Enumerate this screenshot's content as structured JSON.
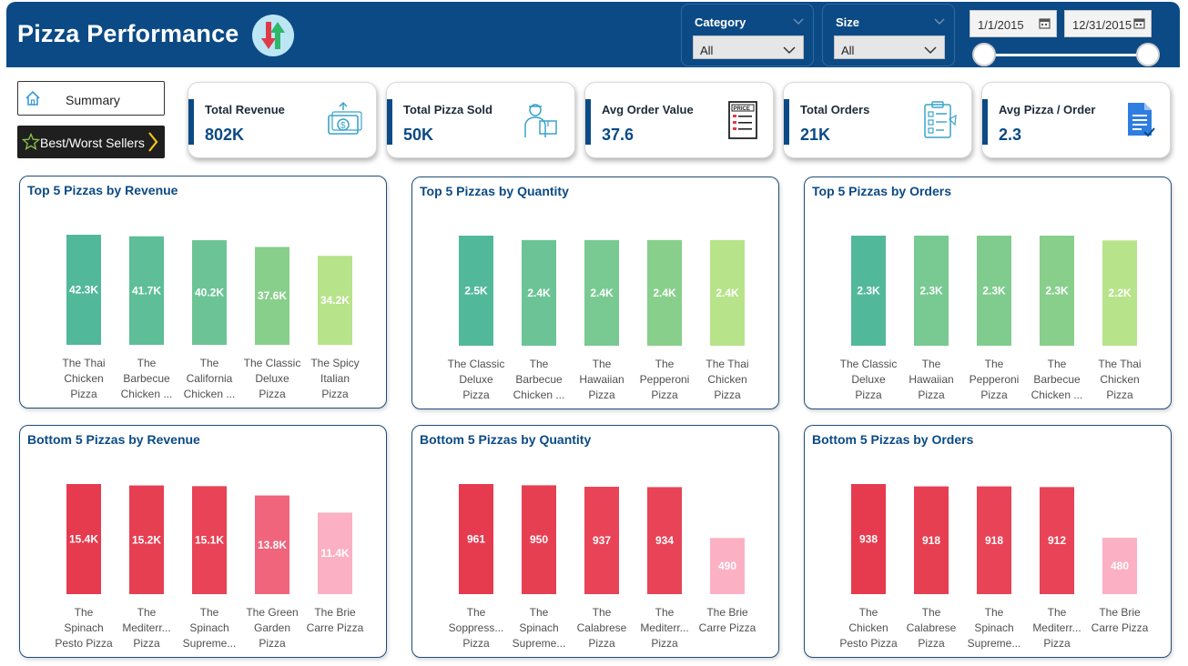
{
  "header": {
    "title": "Pizza Performance",
    "logo_icon": "swap-arrows-icon",
    "colors": {
      "background": "#0b4a85",
      "arrow_down": "#e03a4a",
      "arrow_up": "#2db86a"
    }
  },
  "filters": {
    "category": {
      "label": "Category",
      "value": "All"
    },
    "size": {
      "label": "Size",
      "value": "All"
    },
    "date_start": "1/1/2015",
    "date_end": "12/31/2015"
  },
  "nav": {
    "summary_label": "Summary",
    "best_worst_label": "Best/Worst Sellers"
  },
  "kpis": [
    {
      "label": "Total Revenue",
      "value": "802K",
      "icon": "money-icon"
    },
    {
      "label": "Total Pizza Sold",
      "value": "50K",
      "icon": "delivery-person-icon"
    },
    {
      "label": "Avg Order Value",
      "value": "37.6",
      "icon": "price-list-icon"
    },
    {
      "label": "Total Orders",
      "value": "21K",
      "icon": "checklist-icon"
    },
    {
      "label": "Avg Pizza / Order",
      "value": "2.3",
      "icon": "document-icon"
    }
  ],
  "chart_data": [
    {
      "type": "bar",
      "title": "Top 5 Pizzas by Revenue",
      "categories": [
        [
          "The Thai",
          "Chicken",
          "Pizza"
        ],
        [
          "The",
          "Barbecue",
          "Chicken ..."
        ],
        [
          "The",
          "California",
          "Chicken ..."
        ],
        [
          "The Classic",
          "Deluxe",
          "Pizza"
        ],
        [
          "The Spicy",
          "Italian",
          "Pizza"
        ]
      ],
      "values": [
        42.3,
        41.7,
        40.2,
        37.6,
        34.2
      ],
      "labels": [
        "42.3K",
        "41.7K",
        "40.2K",
        "37.6K",
        "34.2K"
      ],
      "colors": [
        "#52b89a",
        "#5dbe98",
        "#6cc496",
        "#88cf8c",
        "#b7e38a"
      ]
    },
    {
      "type": "bar",
      "title": "Top 5 Pizzas by Quantity",
      "categories": [
        [
          "The Classic",
          "Deluxe",
          "Pizza"
        ],
        [
          "The",
          "Barbecue",
          "Chicken ..."
        ],
        [
          "The",
          "Hawaiian",
          "Pizza"
        ],
        [
          "The",
          "Pepperoni",
          "Pizza"
        ],
        [
          "The Thai",
          "Chicken",
          "Pizza"
        ]
      ],
      "values": [
        2.5,
        2.4,
        2.4,
        2.4,
        2.4
      ],
      "labels": [
        "2.5K",
        "2.4K",
        "2.4K",
        "2.4K",
        "2.4K"
      ],
      "colors": [
        "#52b89a",
        "#6cc496",
        "#78c992",
        "#88cf8c",
        "#b7e38a"
      ]
    },
    {
      "type": "bar",
      "title": "Top 5 Pizzas by Orders",
      "categories": [
        [
          "The Classic",
          "Deluxe",
          "Pizza"
        ],
        [
          "The",
          "Hawaiian",
          "Pizza"
        ],
        [
          "The",
          "Pepperoni",
          "Pizza"
        ],
        [
          "The",
          "Barbecue",
          "Chicken ..."
        ],
        [
          "The Thai",
          "Chicken",
          "Pizza"
        ]
      ],
      "values": [
        2.3,
        2.3,
        2.3,
        2.3,
        2.2
      ],
      "labels": [
        "2.3K",
        "2.3K",
        "2.3K",
        "2.3K",
        "2.2K"
      ],
      "colors": [
        "#52b89a",
        "#78c992",
        "#80cc8f",
        "#88cf8c",
        "#b7e38a"
      ]
    },
    {
      "type": "bar",
      "title": "Bottom 5 Pizzas by Revenue",
      "categories": [
        [
          "The",
          "Spinach",
          "Pesto Pizza"
        ],
        [
          "The",
          "Mediterr...",
          "Pizza"
        ],
        [
          "The",
          "Spinach",
          "Supreme..."
        ],
        [
          "The Green",
          "Garden",
          "Pizza"
        ],
        [
          "The Brie",
          "Carre Pizza"
        ]
      ],
      "values": [
        15.4,
        15.2,
        15.1,
        13.8,
        11.4
      ],
      "labels": [
        "15.4K",
        "15.2K",
        "15.1K",
        "13.8K",
        "11.4K"
      ],
      "colors": [
        "#e63a4e",
        "#e63f52",
        "#e84356",
        "#f0647c",
        "#fbb0c4"
      ]
    },
    {
      "type": "bar",
      "title": "Bottom 5 Pizzas by Quantity",
      "categories": [
        [
          "The",
          "Soppress...",
          "Pizza"
        ],
        [
          "The",
          "Spinach",
          "Supreme..."
        ],
        [
          "The",
          "Calabrese",
          "Pizza"
        ],
        [
          "The",
          "Mediterr...",
          "Pizza"
        ],
        [
          "The Brie",
          "Carre Pizza"
        ]
      ],
      "values": [
        961,
        950,
        937,
        934,
        490
      ],
      "labels": [
        "961",
        "950",
        "937",
        "934",
        "490"
      ],
      "colors": [
        "#e63a4e",
        "#e63f52",
        "#e84356",
        "#e84356",
        "#fbb0c4"
      ]
    },
    {
      "type": "bar",
      "title": "Bottom 5 Pizzas by Orders",
      "categories": [
        [
          "The",
          "Chicken",
          "Pesto Pizza"
        ],
        [
          "The",
          "Calabrese",
          "Pizza"
        ],
        [
          "The",
          "Spinach",
          "Supreme..."
        ],
        [
          "The",
          "Mediterr...",
          "Pizza"
        ],
        [
          "The Brie",
          "Carre Pizza"
        ]
      ],
      "values": [
        938,
        918,
        918,
        912,
        480
      ],
      "labels": [
        "938",
        "918",
        "918",
        "912",
        "480"
      ],
      "colors": [
        "#e63a4e",
        "#e63f52",
        "#e84356",
        "#e84356",
        "#fbb0c4"
      ]
    }
  ]
}
